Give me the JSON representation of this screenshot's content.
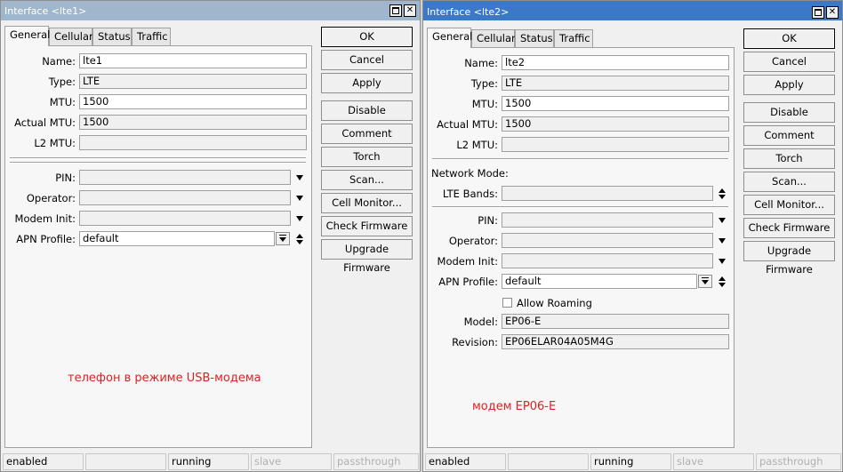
{
  "window1": {
    "title": "Interface <lte1>",
    "tabs": [
      "General",
      "Cellular",
      "Status",
      "Traffic"
    ],
    "fields": {
      "name_label": "Name:",
      "name_value": "lte1",
      "type_label": "Type:",
      "type_value": "LTE",
      "mtu_label": "MTU:",
      "mtu_value": "1500",
      "actual_mtu_label": "Actual MTU:",
      "actual_mtu_value": "1500",
      "l2mtu_label": "L2 MTU:",
      "l2mtu_value": "",
      "pin_label": "PIN:",
      "operator_label": "Operator:",
      "modem_init_label": "Modem Init:",
      "apn_label": "APN Profile:",
      "apn_value": "default"
    },
    "buttons": [
      "OK",
      "Cancel",
      "Apply",
      "Disable",
      "Comment",
      "Torch",
      "Scan...",
      "Cell Monitor...",
      "Check Firmware",
      "Upgrade Firmware"
    ],
    "note": "телефон в режиме USB-модема",
    "status": [
      "enabled",
      "",
      "running",
      "slave",
      "passthrough"
    ]
  },
  "window2": {
    "title": "Interface <lte2>",
    "tabs": [
      "General",
      "Cellular",
      "Status",
      "Traffic"
    ],
    "fields": {
      "name_label": "Name:",
      "name_value": "lte2",
      "type_label": "Type:",
      "type_value": "LTE",
      "mtu_label": "MTU:",
      "mtu_value": "1500",
      "actual_mtu_label": "Actual MTU:",
      "actual_mtu_value": "1500",
      "l2mtu_label": "L2 MTU:",
      "l2mtu_value": "",
      "network_mode_label": "Network Mode:",
      "lte_bands_label": "LTE Bands:",
      "pin_label": "PIN:",
      "operator_label": "Operator:",
      "modem_init_label": "Modem Init:",
      "apn_label": "APN Profile:",
      "apn_value": "default",
      "allow_roaming_label": "Allow Roaming",
      "model_label": "Model:",
      "model_value": "EP06-E",
      "revision_label": "Revision:",
      "revision_value": "EP06ELAR04A05M4G"
    },
    "buttons": [
      "OK",
      "Cancel",
      "Apply",
      "Disable",
      "Comment",
      "Torch",
      "Scan...",
      "Cell Monitor...",
      "Check Firmware",
      "Upgrade Firmware"
    ],
    "note": "модем EP06-E",
    "status": [
      "enabled",
      "",
      "running",
      "slave",
      "passthrough"
    ]
  }
}
